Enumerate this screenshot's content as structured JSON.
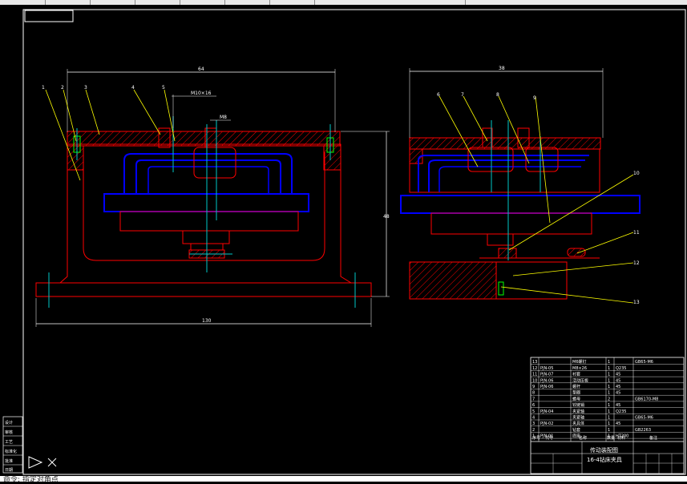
{
  "app": {
    "status_text": "命令: 指定对角点"
  },
  "views": {
    "front": {
      "width_top": "64",
      "width_bottom": "130",
      "height": "48",
      "bolt_spacing": "M10×16",
      "pitch_note": "M8",
      "balloons": [
        "1",
        "2",
        "3",
        "4",
        "5"
      ]
    },
    "side": {
      "width_top": "38",
      "balloons": [
        "6",
        "7",
        "8",
        "9",
        "10",
        "11",
        "12",
        "13"
      ]
    }
  },
  "title_block": {
    "drawing_title": "传动装配图",
    "drawing_subtitle": "16-4钻床夹具",
    "rows": [
      {
        "no": "13",
        "code": "",
        "name": "M6螺钉",
        "qty": "1",
        "mat": "",
        "note": "GB65-M6"
      },
      {
        "no": "12",
        "code": "PJN-05",
        "name": "M8×26",
        "qty": "1",
        "mat": "Q235",
        "note": ""
      },
      {
        "no": "11",
        "code": "PJN-07",
        "name": "衬套",
        "qty": "1",
        "mat": "45",
        "note": ""
      },
      {
        "no": "10",
        "code": "PJN-06",
        "name": "活动压板",
        "qty": "1",
        "mat": "45",
        "note": ""
      },
      {
        "no": "9",
        "code": "PJN-06",
        "name": "螺杆",
        "qty": "1",
        "mat": "45",
        "note": ""
      },
      {
        "no": "8",
        "code": "",
        "name": "垫圈",
        "qty": "1",
        "mat": "45",
        "note": ""
      },
      {
        "no": "7",
        "code": "",
        "name": "螺母",
        "qty": "2",
        "mat": "",
        "note": "GB6170-M8"
      },
      {
        "no": "6",
        "code": "",
        "name": "铰链销",
        "qty": "1",
        "mat": "45",
        "note": ""
      },
      {
        "no": "5",
        "code": "PJN-04",
        "name": "夹紧轴",
        "qty": "1",
        "mat": "Q235",
        "note": ""
      },
      {
        "no": "4",
        "code": "",
        "name": "夹紧轴",
        "qty": "1",
        "mat": "",
        "note": "GB65-M6"
      },
      {
        "no": "3",
        "code": "PJN-02",
        "name": "夹具体",
        "qty": "1",
        "mat": "45",
        "note": ""
      },
      {
        "no": "2",
        "code": "",
        "name": "钻套",
        "qty": "1",
        "mat": "",
        "note": "GB2263"
      },
      {
        "no": "1",
        "code": "PJN-01",
        "name": "底座",
        "qty": "1",
        "mat": "HT200",
        "note": ""
      }
    ],
    "header": [
      "序号",
      "代号",
      "名称",
      "数量",
      "材料",
      "备注"
    ]
  },
  "left_strip": {
    "labels": [
      "设计",
      "审核",
      "工艺",
      "标准化",
      "批准",
      "日期"
    ]
  },
  "colors": {
    "red": "#ff0000",
    "blue": "#0000ff",
    "cyan": "#00c8c8",
    "yellow": "#ffff00",
    "white": "#ffffff",
    "green": "#00ff00"
  }
}
